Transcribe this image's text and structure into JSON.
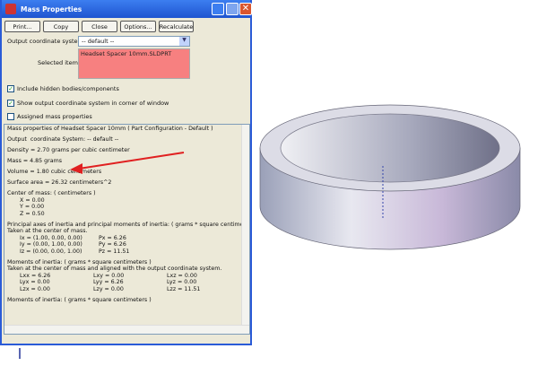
{
  "window": {
    "title": "Mass Properties"
  },
  "toolbar": {
    "print": "Print...",
    "copy": "Copy",
    "close": "Close",
    "options": "Options...",
    "recalculate": "Recalculate"
  },
  "form": {
    "coord_label": "Output coordinate system:",
    "coord_value": "-- default --",
    "selected_label": "Selected items:",
    "selected_value": "Headset Spacer 10mm.SLDPRT"
  },
  "options": [
    {
      "label": "Include hidden bodies/components",
      "checked": true
    },
    {
      "label": "Show output coordinate system in corner of window",
      "checked": true
    },
    {
      "label": "Assigned mass properties",
      "checked": false
    }
  ],
  "output": {
    "header": "Mass properties of Headset Spacer 10mm ( Part Configuration - Default )",
    "coord": "Output  coordinate System: -- default --",
    "density": "Density = 2.70 grams per cubic centimeter",
    "mass": "Mass = 4.85 grams",
    "volume": "Volume = 1.80 cubic centimeters",
    "surface": "Surface area = 26.32 centimeters^2",
    "com_title": "Center of mass: ( centimeters )",
    "com": [
      "X = 0.00",
      "Y = 0.00",
      "Z = 0.50"
    ],
    "principal_title": "Principal axes of inertia and principal moments of inertia: ( grams * square centimeters )",
    "principal_sub": "Taken at the center of mass.",
    "principal": [
      [
        "Ix = (1.00, 0.00, 0.00)",
        "Px = 6.26"
      ],
      [
        "Iy = (0.00, 1.00, 0.00)",
        "Py = 6.26"
      ],
      [
        "Iz = (0.00, 0.00, 1.00)",
        "Pz = 11.51"
      ]
    ],
    "moi_title": "Moments of inertia: ( grams * square centimeters )",
    "moi_sub": "Taken at the center of mass and aligned with the output coordinate system.",
    "moi": [
      [
        "Lxx = 6.26",
        "Lxy = 0.00",
        "Lxz = 0.00"
      ],
      [
        "Lyx = 0.00",
        "Lyy = 6.26",
        "Lyz = 0.00"
      ],
      [
        "Lzx = 0.00",
        "Lzy = 0.00",
        "Lzz = 11.51"
      ]
    ],
    "moi2_title": "Moments of inertia: ( grams * square centimeters )"
  },
  "colors": {
    "selected_bg": "#f78080",
    "arrow": "#e02020",
    "titlebar": "#2a5bd7"
  }
}
